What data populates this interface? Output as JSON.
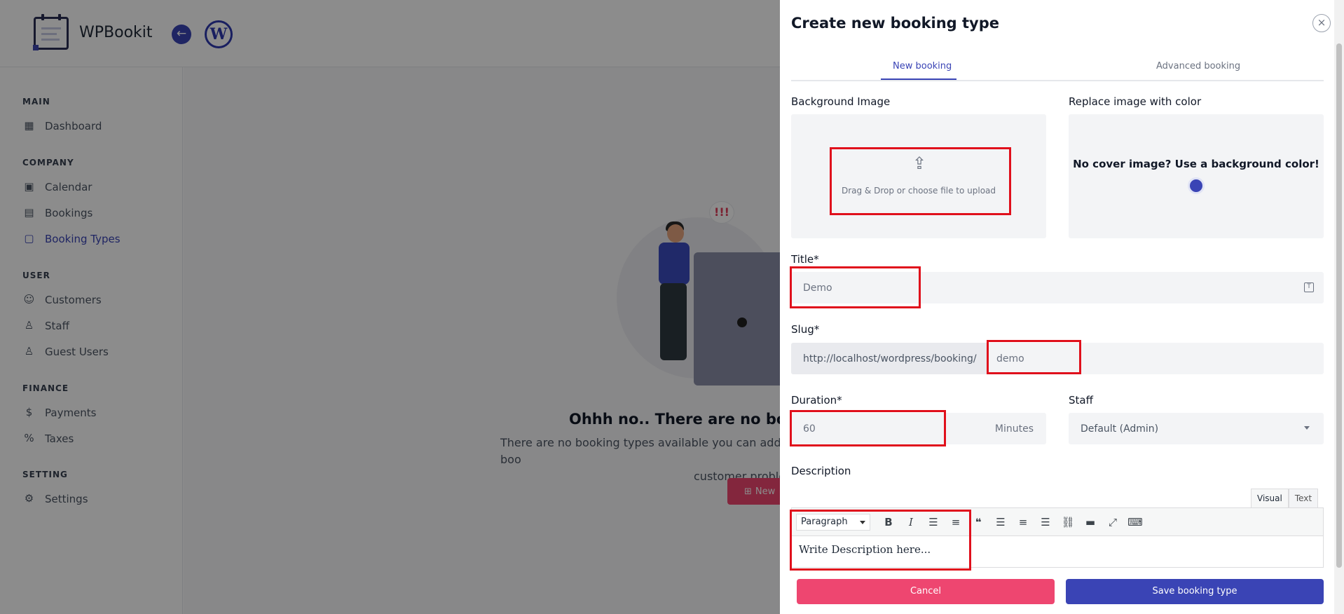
{
  "app": {
    "brand": "WPBookit",
    "back_icon": "arrow-left-icon",
    "wp_logo": "W"
  },
  "sidebar": {
    "sections": [
      {
        "title": "MAIN"
      },
      {
        "title": "COMPANY"
      },
      {
        "title": "USER"
      },
      {
        "title": "FINANCE"
      },
      {
        "title": "SETTING"
      }
    ],
    "items": [
      {
        "label": "Dashboard",
        "icon": "grid-icon"
      },
      {
        "label": "Calendar",
        "icon": "calendar-icon"
      },
      {
        "label": "Bookings",
        "icon": "calendar-grid-icon"
      },
      {
        "label": "Booking Types",
        "icon": "calendar-blank-icon",
        "active": true
      },
      {
        "label": "Customers",
        "icon": "users-icon"
      },
      {
        "label": "Staff",
        "icon": "user-icon"
      },
      {
        "label": "Guest Users",
        "icon": "guest-icon"
      },
      {
        "label": "Payments",
        "icon": "dollar-icon"
      },
      {
        "label": "Taxes",
        "icon": "percent-icon"
      },
      {
        "label": "Settings",
        "icon": "gear-icon"
      }
    ]
  },
  "empty_state": {
    "title": "Ohhh no.. There are no booking",
    "subtitle_line1": "There are no booking types available you can add boo",
    "subtitle_line2": "customer proble",
    "alert": "!!!",
    "new_button": "New"
  },
  "drawer": {
    "title": "Create new booking type",
    "close_icon": "close-icon",
    "tabs": [
      {
        "label": "New booking",
        "active": true
      },
      {
        "label": "Advanced booking",
        "active": false
      }
    ],
    "background_image": {
      "label": "Background Image",
      "upload_text": "Drag & Drop or choose file to upload",
      "icon": "upload-icon"
    },
    "replace_color": {
      "label": "Replace image with color",
      "text": "No cover image? Use a background color!",
      "color": "#3a44b5"
    },
    "title_field": {
      "label": "Title*",
      "value": "Demo"
    },
    "slug_field": {
      "label": "Slug*",
      "prefix": "http://localhost/wordpress/booking/",
      "value": "demo"
    },
    "duration_field": {
      "label": "Duration*",
      "value": "60",
      "unit": "Minutes"
    },
    "staff_field": {
      "label": "Staff",
      "value": "Default (Admin)"
    },
    "description": {
      "label": "Description",
      "editor_tabs": [
        "Visual",
        "Text"
      ],
      "format": "Paragraph",
      "content": "Write Description here..."
    },
    "buttons": {
      "cancel": "Cancel",
      "save": "Save booking type"
    }
  },
  "colors": {
    "primary": "#3a44b5",
    "danger": "#ee4670",
    "highlight": "#e0101c"
  }
}
